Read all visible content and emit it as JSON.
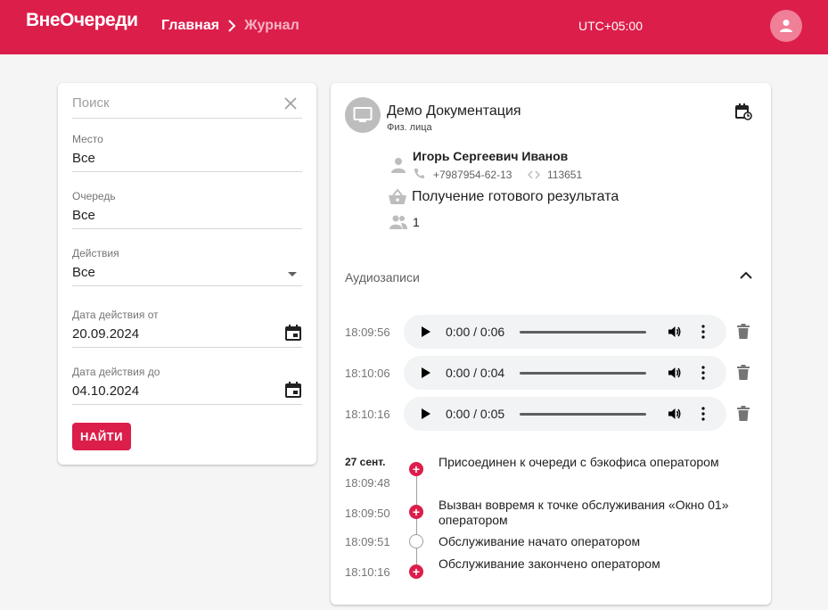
{
  "header": {
    "logo": "ВнеОчереди",
    "breadcrumb_home": "Главная",
    "breadcrumb_current": "Журнал",
    "timezone": "UTC+05:00",
    "brand_color": "#dc1e4b"
  },
  "filters": {
    "search_placeholder": "Поиск",
    "place_label": "Место",
    "place_value": "Все",
    "queue_label": "Очередь",
    "queue_value": "Все",
    "actions_label": "Действия",
    "actions_value": "Все",
    "date_from_label": "Дата действия от",
    "date_from_value": "20.09.2024",
    "date_to_label": "Дата действия до",
    "date_to_value": "04.10.2024",
    "find_button": "НАЙТИ"
  },
  "detail": {
    "service_title": "Демо Документация",
    "service_subtitle": "Физ. лица",
    "client_name": "Игорь Сергеевич Иванов",
    "phone": "+7987954-62-13",
    "code": "113651",
    "service_name": "Получение готового результата",
    "people_count": "1",
    "audio_header": "Аудиозаписи",
    "audio": [
      {
        "time": "18:09:56",
        "progress": "0:00 / 0:06"
      },
      {
        "time": "18:10:06",
        "progress": "0:00 / 0:04"
      },
      {
        "time": "18:10:16",
        "progress": "0:00 / 0:05"
      }
    ],
    "timeline_date": "27 сент.",
    "events": [
      {
        "time": "18:09:48",
        "text": "Присоединен к очереди с бэкофиса оператором",
        "icon": "plus"
      },
      {
        "time": "18:09:50",
        "text": "Вызван вовремя к точке обслуживания «Окно 01» оператором",
        "icon": "plus"
      },
      {
        "time": "18:09:51",
        "text": "Обслуживание начато оператором",
        "icon": "empty"
      },
      {
        "time": "18:10:16",
        "text": "Обслуживание закончено оператором",
        "icon": "plus"
      }
    ]
  }
}
